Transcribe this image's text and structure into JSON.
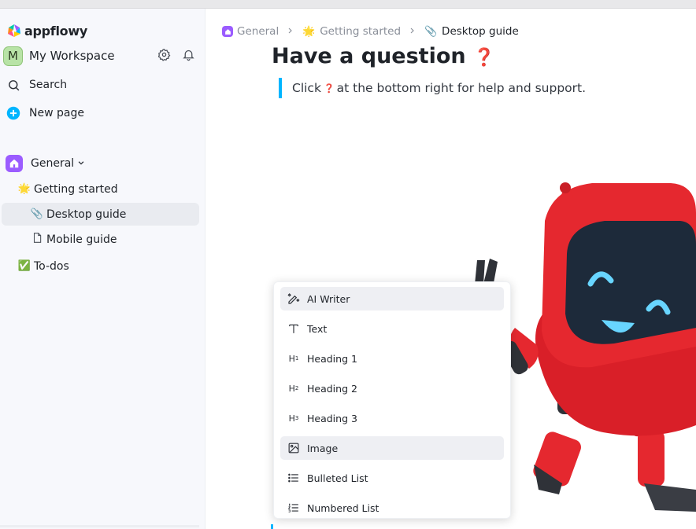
{
  "app": {
    "name": "appflowy"
  },
  "workspace": {
    "avatar_letter": "M",
    "name": "My Workspace"
  },
  "sidebar": {
    "search_label": "Search",
    "new_page_label": "New page",
    "space": {
      "name": "General"
    },
    "pages": [
      {
        "emoji": "🌟",
        "label": "Getting started"
      },
      {
        "emoji": "📎",
        "label": "Desktop guide"
      },
      {
        "emoji": "",
        "label": "Mobile guide"
      },
      {
        "emoji": "✅",
        "label": "To-dos"
      }
    ]
  },
  "breadcrumb": [
    {
      "label": "General"
    },
    {
      "emoji": "🌟",
      "label": "Getting started"
    },
    {
      "emoji": "📎",
      "label": "Desktop guide"
    }
  ],
  "document": {
    "heading": "Have a question",
    "heading_emoji": "❓",
    "quote_prefix": "Click",
    "quote_emoji": "❓",
    "quote_suffix": "at the bottom right for help and support."
  },
  "slash_menu": {
    "items": [
      {
        "icon": "ai-writer-icon",
        "label": "AI Writer"
      },
      {
        "icon": "text-icon",
        "label": "Text"
      },
      {
        "icon": "heading-1-icon",
        "label": "Heading 1"
      },
      {
        "icon": "heading-2-icon",
        "label": "Heading 2"
      },
      {
        "icon": "heading-3-icon",
        "label": "Heading 3"
      },
      {
        "icon": "image-icon",
        "label": "Image"
      },
      {
        "icon": "bulleted-list-icon",
        "label": "Bulleted List"
      },
      {
        "icon": "numbered-list-icon",
        "label": "Numbered List"
      }
    ]
  },
  "colors": {
    "accent": "#00b5ff",
    "purple": "#9b5cff",
    "robot_red": "#e5282f"
  }
}
